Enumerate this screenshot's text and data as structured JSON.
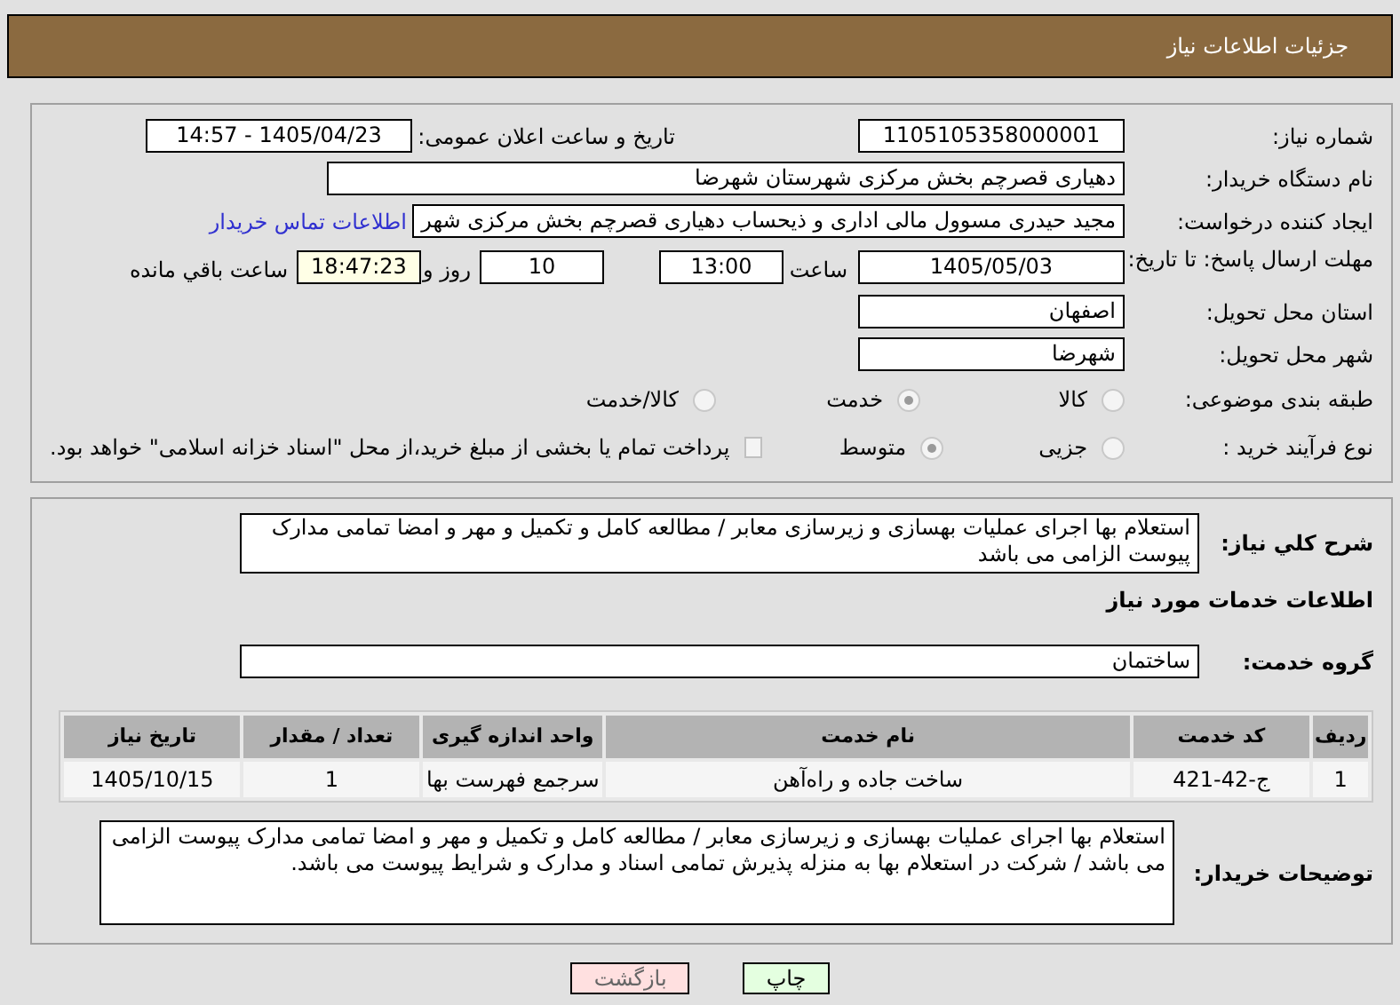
{
  "header": {
    "title": "جزئیات اطلاعات نیاز"
  },
  "need_number": {
    "label": "شماره نیاز:",
    "value": "1105105358000001"
  },
  "announce": {
    "label": "تاریخ و ساعت اعلان عمومی:",
    "value": "1405/04/23 - 14:57"
  },
  "buyer_org": {
    "label": "نام دستگاه خریدار:",
    "value": "دهیاری قصرچم بخش مرکزی شهرستان شهرضا"
  },
  "requester": {
    "label": "ایجاد کننده درخواست:",
    "value": "مجید حیدری مسوول مالی اداری و ذیحساب دهیاری قصرچم بخش مرکزی شهر",
    "link": "اطلاعات تماس خریدار"
  },
  "deadline": {
    "label": "مهلت ارسال پاسخ: تا تاریخ:",
    "date": "1405/05/03",
    "time_label": "ساعت",
    "time": "13:00",
    "days": "10",
    "days_label": "روز و",
    "remaining": "18:47:23",
    "remaining_label": "ساعت باقي مانده"
  },
  "province": {
    "label": "استان محل تحویل:",
    "value": "اصفهان"
  },
  "city": {
    "label": "شهر محل تحویل:",
    "value": "شهرضا"
  },
  "category": {
    "label": "طبقه بندی موضوعی:",
    "options": [
      {
        "label": "کالا",
        "selected": false
      },
      {
        "label": "خدمت",
        "selected": true
      },
      {
        "label": "کالا/خدمت",
        "selected": false
      }
    ]
  },
  "purchase_type": {
    "label": "نوع فرآیند خرید :",
    "options": [
      {
        "label": "جزیی",
        "selected": false
      },
      {
        "label": "متوسط",
        "selected": true
      }
    ],
    "payment": {
      "checked": false,
      "label": "پرداخت تمام یا بخشی از مبلغ خرید،از محل \"اسناد خزانه اسلامی\" خواهد بود."
    }
  },
  "description": {
    "label": "شرح کلي نياز:",
    "value": "استعلام بها اجرای عملیات بهسازی و زیرسازی معابر / مطالعه کامل و تکمیل و مهر و امضا تمامی مدارک پیوست الزامی می باشد"
  },
  "services_title": "اطلاعات خدمات مورد نياز",
  "service_group": {
    "label": "گروه خدمت:",
    "value": "ساختمان"
  },
  "table": {
    "columns": [
      "ردیف",
      "کد خدمت",
      "نام خدمت",
      "واحد اندازه گیری",
      "تعداد / مقدار",
      "تاریخ نیاز"
    ],
    "rows": [
      [
        "1",
        "ج-42-421",
        "ساخت جاده و راه‌آهن",
        "سرجمع فهرست بها",
        "1",
        "1405/10/15"
      ]
    ]
  },
  "buyer_notes": {
    "label": "توضیحات خریدار:",
    "value": "استعلام بها اجرای عملیات بهسازی و زیرسازی معابر / مطالعه کامل و تکمیل و مهر و امضا تمامی مدارک پیوست الزامی می باشد / شرکت در استعلام بها به منزله پذیرش تمامی اسناد و مدارک و شرایط پیوست می باشد."
  },
  "buttons": [
    {
      "label": "چاپ",
      "kind": "print"
    },
    {
      "label": "بازگشت",
      "kind": "back"
    }
  ]
}
